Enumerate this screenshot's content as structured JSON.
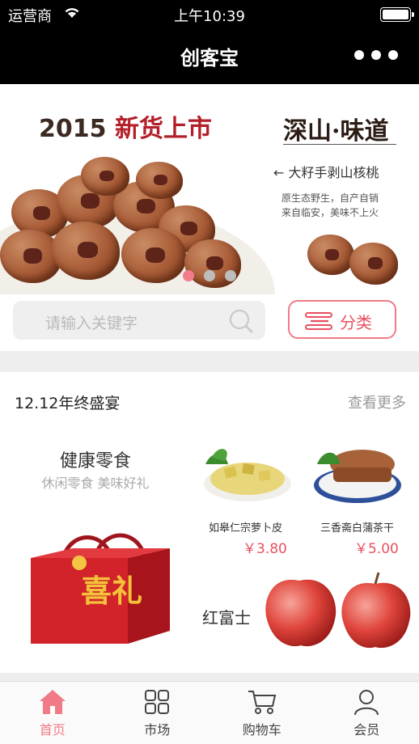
{
  "status_bar": {
    "carrier": "运营商",
    "time": "上午10:39"
  },
  "nav": {
    "title": "创客宝"
  },
  "banner": {
    "headline_year": "2015",
    "headline_text": "新货上市",
    "brand": "深山·味道",
    "tag": "← 大籽手剥山核桃",
    "desc_line1": "原生态野生，自产自销",
    "desc_line2": "来自临安，美味不上火",
    "page_count": 3,
    "active_page": 1
  },
  "search": {
    "placeholder": "请输入关键字",
    "category_label": "分类"
  },
  "section": {
    "title": "12.12年终盛宴",
    "more_label": "查看更多",
    "featured": {
      "title": "健康零食",
      "subtitle": "休闲零食  美味好礼",
      "box_text": "喜礼"
    },
    "products": [
      {
        "name": "如皋仁宗萝卜皮",
        "price": "￥3.80"
      },
      {
        "name": "三香斋白蒲茶干",
        "price": "￥5.00"
      }
    ],
    "apple_label": "红富士"
  },
  "tabbar": {
    "items": [
      {
        "label": "首页",
        "icon": "home-icon",
        "active": true
      },
      {
        "label": "市场",
        "icon": "grid-icon",
        "active": false
      },
      {
        "label": "购物车",
        "icon": "cart-icon",
        "active": false
      },
      {
        "label": "会员",
        "icon": "user-icon",
        "active": false
      }
    ]
  },
  "colors": {
    "accent": "#f07a86",
    "price": "#e8505f",
    "nav_bg": "#000000",
    "banner_red": "#b3202a"
  }
}
